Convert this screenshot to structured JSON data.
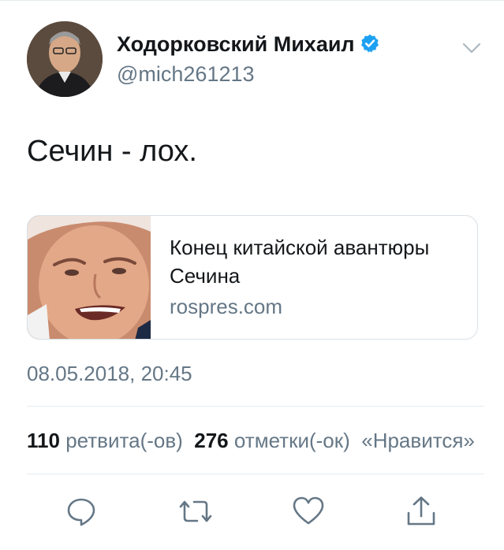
{
  "author": {
    "name": "Ходорковский Михаил",
    "handle": "@mich261213"
  },
  "tweet": {
    "text": "Сечин - лох."
  },
  "link_card": {
    "title": "Конец китайской авантюры Сечина",
    "domain": "rospres.com"
  },
  "timestamp": "08.05.2018, 20:45",
  "stats": {
    "retweets_count": "110",
    "retweets_label": "ретвита(-ов)",
    "likes_count": "276",
    "likes_label": "отметки(-ок)",
    "more_label": "«Нравится»"
  },
  "actions": {
    "icons": [
      "reply-icon",
      "retweet-icon",
      "like-icon",
      "share-icon"
    ]
  },
  "colors": {
    "accent": "#1da1f2",
    "text": "#14171a",
    "secondary": "#657786",
    "border": "#e6ecf0"
  }
}
